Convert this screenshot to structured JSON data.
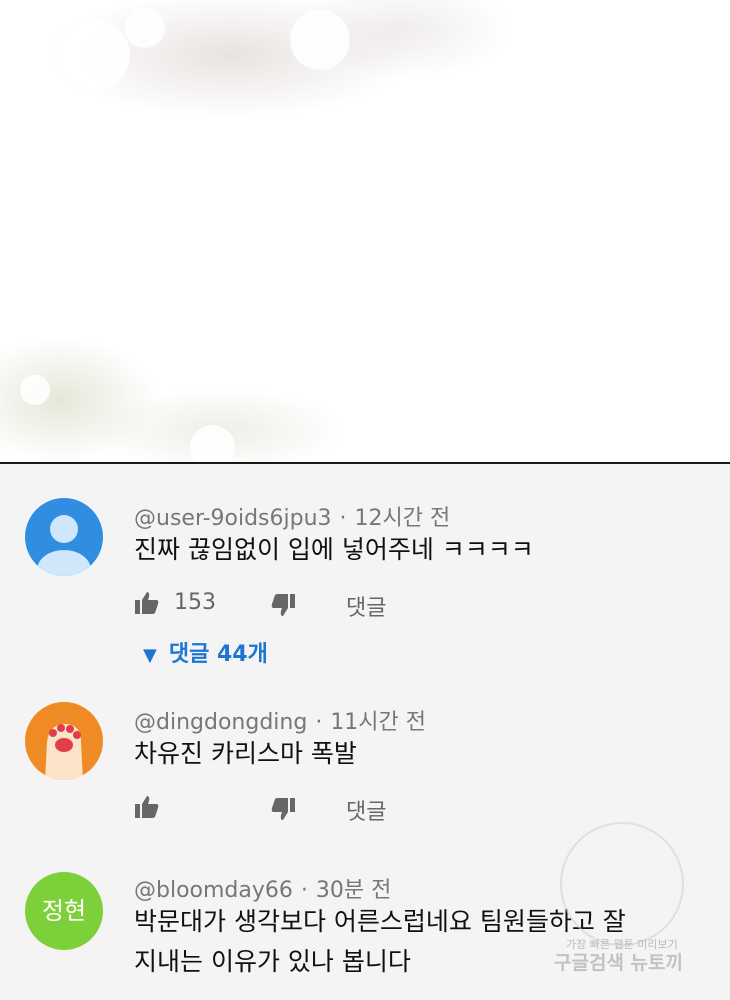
{
  "comments": [
    {
      "author": "@user-9oids6jpu3",
      "time": "12시간 전",
      "text": "진짜 끊임없이 입에 넣어주네 ㅋㅋㅋㅋ",
      "likes": "153",
      "reply_label": "댓글",
      "replies_toggle": "댓글 44개",
      "avatar": "default-user-avatar",
      "avatar_color": "#2f8ee0"
    },
    {
      "author": "@dingdongding",
      "time": "11시간 전",
      "text": "차유진 카리스마 폭발",
      "likes": "",
      "reply_label": "댓글",
      "avatar": "cat-paw-avatar",
      "avatar_color": "#f08a24"
    },
    {
      "author": "@bloomday66",
      "time": "30분 전",
      "text_line1": "박문대가 생각보다 어른스럽네요 팀원들하고 잘",
      "text_line2": "지내는 이유가 있나 봅니다",
      "avatar_text": "정현",
      "avatar_color": "#7ed03a"
    }
  ],
  "watermark": {
    "line1": "가장 빠른 웹툰 미리보기",
    "line2": "구글검색 뉴토끼"
  }
}
